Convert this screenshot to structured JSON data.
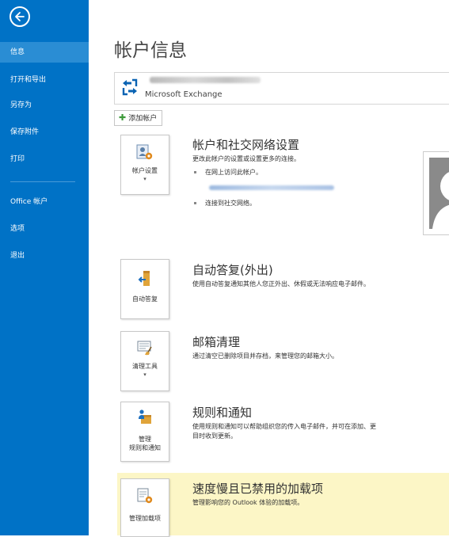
{
  "sidebar": {
    "items": [
      {
        "label": "信息",
        "active": true
      },
      {
        "label": "打开和导出"
      },
      {
        "label": "另存为"
      },
      {
        "label": "保存附件"
      },
      {
        "label": "打印"
      },
      {
        "label": "Office 帐户"
      },
      {
        "label": "选项"
      },
      {
        "label": "退出"
      }
    ]
  },
  "page_title": "帐户信息",
  "account": {
    "type": "Microsoft Exchange"
  },
  "add_account_label": "添加帐户",
  "sections": [
    {
      "title": "帐户和社交网络设置",
      "desc": "更改此帐户的设置或设置更多的连接。",
      "bullets": [
        "在网上访问此帐户。",
        "连接到社交网络。"
      ],
      "tile_label": "帐户设置"
    },
    {
      "title": "自动答复(外出)",
      "desc": "使用自动答复通知其他人您正外出、休假或无法响应电子邮件。",
      "tile_label": "自动答复"
    },
    {
      "title": "邮箱清理",
      "desc": "通过清空已删除项目并存档，来管理您的邮箱大小。",
      "tile_label": "清理工具"
    },
    {
      "title": "规则和通知",
      "desc_line1": "使用规则和通知可以帮助组织您的传入电子邮件，并可在添加、更",
      "desc_line2": "目时收到更新。",
      "tile_label_1": "管理",
      "tile_label_2": "规则和通知"
    },
    {
      "title": "速度慢且已禁用的加载项",
      "desc": "管理影响您的 Outlook 体验的加载项。",
      "tile_label": "管理加载项"
    }
  ],
  "colors": {
    "sidebar": "#0072c6",
    "sidebar_active": "#2a8dd4",
    "highlight": "#fcf6c6"
  }
}
